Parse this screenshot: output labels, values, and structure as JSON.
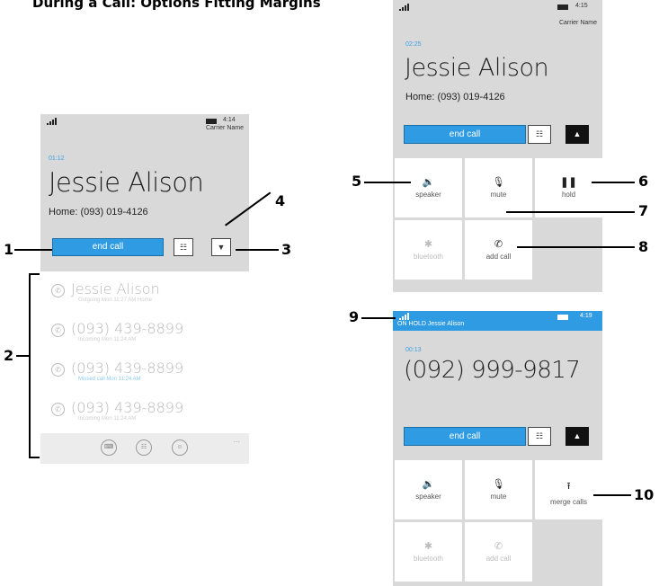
{
  "page_title": "During a Call: Options Fitting Margins",
  "status_bar": {
    "carrier": "Carrier Name",
    "time_a": "4:14",
    "time_b": "4:15",
    "time_c": "4:19"
  },
  "screen_a": {
    "timer": "01:12",
    "name": "Jessie Alison",
    "detail": "Home: (093) 019-4126",
    "end_call": "end call",
    "keypad_icon": "keypad-icon",
    "collapse_icon": "chevron-down-icon",
    "history": [
      {
        "title": "Jessie Alison",
        "sub": "Outgoing Mon 11:27 AM Home",
        "missed": false
      },
      {
        "title": "(093) 439-8899",
        "sub": "Incoming Mon 11:24 AM",
        "missed": false
      },
      {
        "title": "(093) 439-8899",
        "sub": "Missed call Mon 11:24 AM",
        "missed": true
      },
      {
        "title": "(093) 439-8899",
        "sub": "Incoming Mon 11:24 AM",
        "missed": false
      }
    ],
    "more": "..."
  },
  "screen_b": {
    "timer": "02:25",
    "name": "Jessie Alison",
    "detail": "Home: (093) 019-4126",
    "end_call": "end call",
    "tiles": {
      "speaker": "speaker",
      "mute": "mute",
      "hold": "hold",
      "bluetooth": "bluetooth",
      "add_call": "add call"
    }
  },
  "screen_c": {
    "hold_text": "ON HOLD Jessie Alison",
    "timer": "00:13",
    "number": "(092) 999-9817",
    "end_call": "end call",
    "tiles": {
      "speaker": "speaker",
      "mute": "mute",
      "merge": "merge calls",
      "bluetooth": "bluetooth",
      "add_call": "add call"
    }
  },
  "callouts": [
    "1",
    "2",
    "3",
    "4",
    "5",
    "6",
    "7",
    "8",
    "9",
    "10"
  ]
}
